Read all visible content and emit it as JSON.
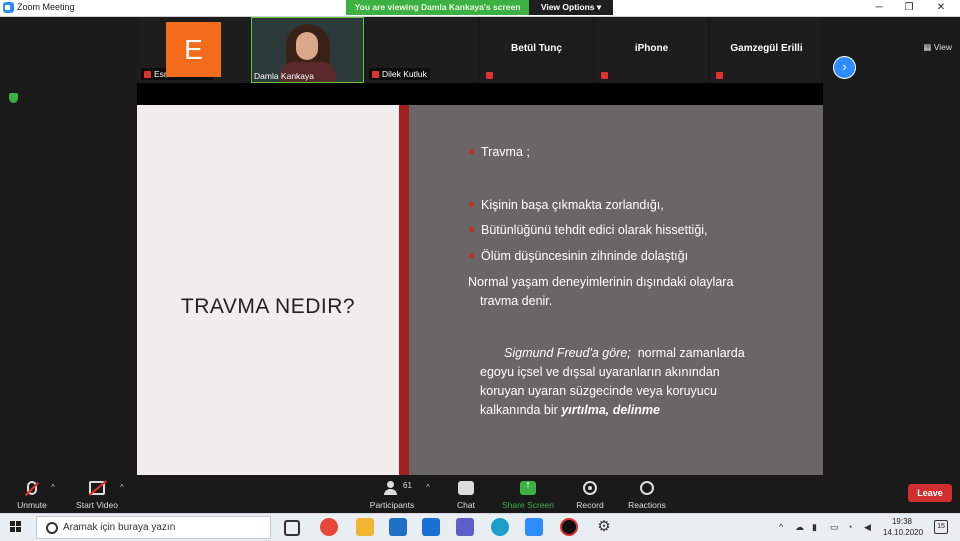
{
  "window": {
    "title": "Zoom Meeting",
    "viewing_banner": "You are viewing Damla Kankaya's screen",
    "view_options": "View Options ▾",
    "minimize": "─",
    "restore": "❐",
    "close": "✕"
  },
  "participants_strip": {
    "tiles": [
      {
        "name": "Esma Dilber ...",
        "initial": "E"
      },
      {
        "name": "Damla Kankaya"
      },
      {
        "name": "Dilek Kutluk"
      },
      {
        "name": "Betül Tunç"
      },
      {
        "name": "iPhone"
      },
      {
        "name": "Gamzegül Erilli"
      }
    ],
    "next_label": "›",
    "view_label": "View"
  },
  "slide": {
    "left_title": "TRAVMA NEDIR?",
    "heading_bullet": "Travma ;",
    "bullets": [
      "Kişinin başa çıkmakta zorlandığı,",
      "Bütünlüğünü tehdit edici olarak hissettiği,",
      "Ölüm düşüncesinin zihninde dolaştığı"
    ],
    "para1_line1": "Normal yaşam deneyimlerinin dışındaki olaylara",
    "para1_line2": "travma denir.",
    "para2_italic": "Sigmund Freud'a göre;",
    "para2_line1_rest": "normal zamanlarda",
    "para2_line2": "egoyu içsel ve dışsal uyaranların akınından",
    "para2_line3": "koruyan uyaran süzgecinde veya koruyucu",
    "para2_line4_start": "kalkanında bir",
    "para2_line4_bold": "yırtılma, delinme"
  },
  "toolbar": {
    "unmute": "Unmute",
    "start_video": "Start Video",
    "participants": "Participants",
    "participants_count": "61",
    "chat": "Chat",
    "share_screen": "Share Screen",
    "record": "Record",
    "reactions": "Reactions",
    "leave": "Leave",
    "caret": "^"
  },
  "taskbar": {
    "search_placeholder": "Aramak için buraya yazın",
    "time": "19:38",
    "date": "14.10.2020",
    "notifications": "15"
  },
  "colors": {
    "zoom_blue": "#2d8cff",
    "green": "#3cb043",
    "leave_red": "#d12f2f",
    "slide_red_bar": "#a32020",
    "slide_gray": "#6a6667"
  }
}
